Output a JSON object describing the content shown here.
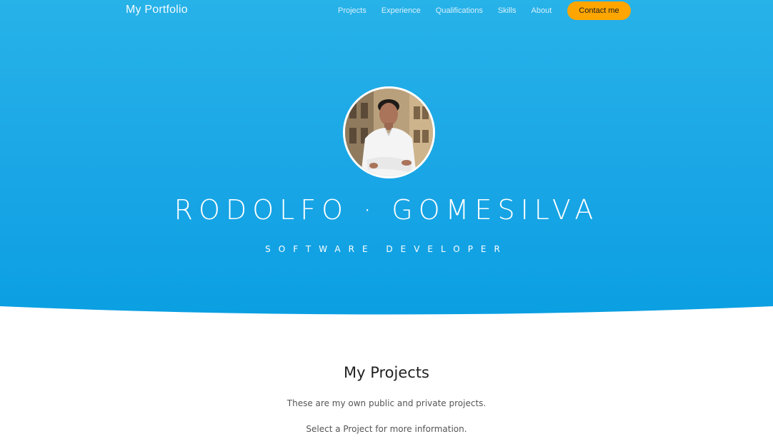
{
  "navbar": {
    "brand": "My Portfolio",
    "links": [
      "Projects",
      "Experience",
      "Qualifications",
      "Skills",
      "About"
    ],
    "contact_label": "Contact me"
  },
  "hero": {
    "name": "RODOLFO · GOMESILVA",
    "role": "SOFTWARE DEVELOPER",
    "avatar_icon": "profile-photo"
  },
  "projects_section": {
    "title": "My Projects",
    "line1": "These are my own public and private projects.",
    "line2": "Select a Project for more information."
  },
  "colors": {
    "hero_top": "#27b2e8",
    "hero_bottom": "#0a9fe2",
    "accent_button": "#ffa500"
  }
}
